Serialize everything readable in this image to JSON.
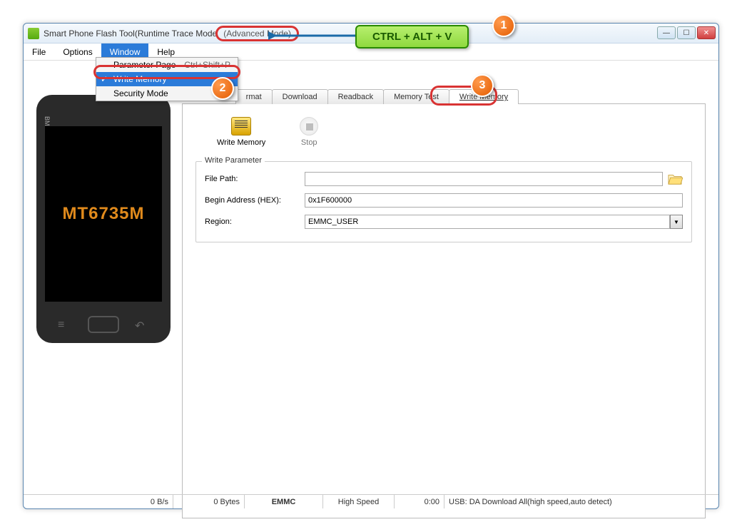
{
  "title_prefix": "Smart Phone Flash Tool(Runtime Trace Mode",
  "title_mode": "(Advanced Mode)",
  "menubar": {
    "file": "File",
    "options": "Options",
    "window": "Window",
    "help": "Help"
  },
  "dropdown": {
    "param": "Parameter Page",
    "param_sc": "Ctrl+Shift+P",
    "write": "Write Memory",
    "security": "Security Mode"
  },
  "tabs": {
    "format": "rmat",
    "download": "Download",
    "readback": "Readback",
    "memtest": "Memory Test",
    "writemem": "Write Memory"
  },
  "toolbar": {
    "write": "Write Memory",
    "stop": "Stop"
  },
  "group": {
    "legend": "Write Parameter",
    "file_label": "File Path:",
    "file_value": "",
    "begin_label": "Begin Address (HEX):",
    "begin_value": "0x1F600000",
    "region_label": "Region:",
    "region_value": "EMMC_USER"
  },
  "phone": {
    "bm": "BM",
    "chip": "MT6735M"
  },
  "status": {
    "speed": "0 B/s",
    "bytes": "0 Bytes",
    "emmc": "EMMC",
    "hs": "High Speed",
    "time": "0:00",
    "usb": "USB: DA Download All(high speed,auto detect)"
  },
  "ann": {
    "shortcut": "CTRL + ALT + V",
    "b1": "1",
    "b2": "2",
    "b3": "3"
  }
}
